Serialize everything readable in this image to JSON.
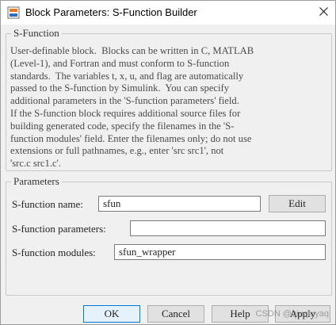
{
  "window": {
    "title": "Block Parameters: S-Function Builder",
    "icon": "simulink-block-icon",
    "close_icon": "close-icon"
  },
  "sfunction_group": {
    "legend": "S-Function",
    "description": "User-definable block.  Blocks can be written in C, MATLAB\n(Level-1), and Fortran and must conform to S-function\nstandards.  The variables t, x, u, and flag are automatically\npassed to the S-function by Simulink.  You can specify\nadditional parameters in the 'S-function parameters' field.\nIf the S-function block requires additional source files for\nbuilding generated code, specify the filenames in the 'S-\nfunction modules' field. Enter the filenames only; do not use\nextensions or full pathnames, e.g., enter 'src src1', not\n'src.c src1.c'."
  },
  "parameters_group": {
    "legend": "Parameters",
    "name_label": "S-function name:",
    "name_value": "sfun",
    "edit_button": "Edit",
    "params_label": "S-function parameters:",
    "params_value": "",
    "modules_label": "S-function modules:",
    "modules_value": "sfun_wrapper"
  },
  "buttons": {
    "ok": "OK",
    "cancel": "Cancel",
    "help": "Help",
    "apply": "Apply"
  },
  "watermark": "CSDN @qiuqiuyaq"
}
